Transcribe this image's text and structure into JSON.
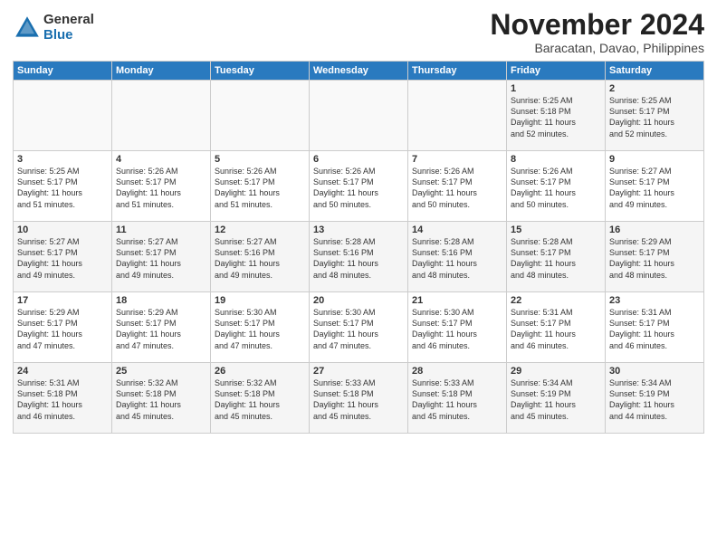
{
  "logo": {
    "general": "General",
    "blue": "Blue"
  },
  "header": {
    "month": "November 2024",
    "location": "Baracatan, Davao, Philippines"
  },
  "weekdays": [
    "Sunday",
    "Monday",
    "Tuesday",
    "Wednesday",
    "Thursday",
    "Friday",
    "Saturday"
  ],
  "weeks": [
    [
      {
        "day": "",
        "info": ""
      },
      {
        "day": "",
        "info": ""
      },
      {
        "day": "",
        "info": ""
      },
      {
        "day": "",
        "info": ""
      },
      {
        "day": "",
        "info": ""
      },
      {
        "day": "1",
        "info": "Sunrise: 5:25 AM\nSunset: 5:18 PM\nDaylight: 11 hours\nand 52 minutes."
      },
      {
        "day": "2",
        "info": "Sunrise: 5:25 AM\nSunset: 5:17 PM\nDaylight: 11 hours\nand 52 minutes."
      }
    ],
    [
      {
        "day": "3",
        "info": "Sunrise: 5:25 AM\nSunset: 5:17 PM\nDaylight: 11 hours\nand 51 minutes."
      },
      {
        "day": "4",
        "info": "Sunrise: 5:26 AM\nSunset: 5:17 PM\nDaylight: 11 hours\nand 51 minutes."
      },
      {
        "day": "5",
        "info": "Sunrise: 5:26 AM\nSunset: 5:17 PM\nDaylight: 11 hours\nand 51 minutes."
      },
      {
        "day": "6",
        "info": "Sunrise: 5:26 AM\nSunset: 5:17 PM\nDaylight: 11 hours\nand 50 minutes."
      },
      {
        "day": "7",
        "info": "Sunrise: 5:26 AM\nSunset: 5:17 PM\nDaylight: 11 hours\nand 50 minutes."
      },
      {
        "day": "8",
        "info": "Sunrise: 5:26 AM\nSunset: 5:17 PM\nDaylight: 11 hours\nand 50 minutes."
      },
      {
        "day": "9",
        "info": "Sunrise: 5:27 AM\nSunset: 5:17 PM\nDaylight: 11 hours\nand 49 minutes."
      }
    ],
    [
      {
        "day": "10",
        "info": "Sunrise: 5:27 AM\nSunset: 5:17 PM\nDaylight: 11 hours\nand 49 minutes."
      },
      {
        "day": "11",
        "info": "Sunrise: 5:27 AM\nSunset: 5:17 PM\nDaylight: 11 hours\nand 49 minutes."
      },
      {
        "day": "12",
        "info": "Sunrise: 5:27 AM\nSunset: 5:16 PM\nDaylight: 11 hours\nand 49 minutes."
      },
      {
        "day": "13",
        "info": "Sunrise: 5:28 AM\nSunset: 5:16 PM\nDaylight: 11 hours\nand 48 minutes."
      },
      {
        "day": "14",
        "info": "Sunrise: 5:28 AM\nSunset: 5:16 PM\nDaylight: 11 hours\nand 48 minutes."
      },
      {
        "day": "15",
        "info": "Sunrise: 5:28 AM\nSunset: 5:17 PM\nDaylight: 11 hours\nand 48 minutes."
      },
      {
        "day": "16",
        "info": "Sunrise: 5:29 AM\nSunset: 5:17 PM\nDaylight: 11 hours\nand 48 minutes."
      }
    ],
    [
      {
        "day": "17",
        "info": "Sunrise: 5:29 AM\nSunset: 5:17 PM\nDaylight: 11 hours\nand 47 minutes."
      },
      {
        "day": "18",
        "info": "Sunrise: 5:29 AM\nSunset: 5:17 PM\nDaylight: 11 hours\nand 47 minutes."
      },
      {
        "day": "19",
        "info": "Sunrise: 5:30 AM\nSunset: 5:17 PM\nDaylight: 11 hours\nand 47 minutes."
      },
      {
        "day": "20",
        "info": "Sunrise: 5:30 AM\nSunset: 5:17 PM\nDaylight: 11 hours\nand 47 minutes."
      },
      {
        "day": "21",
        "info": "Sunrise: 5:30 AM\nSunset: 5:17 PM\nDaylight: 11 hours\nand 46 minutes."
      },
      {
        "day": "22",
        "info": "Sunrise: 5:31 AM\nSunset: 5:17 PM\nDaylight: 11 hours\nand 46 minutes."
      },
      {
        "day": "23",
        "info": "Sunrise: 5:31 AM\nSunset: 5:17 PM\nDaylight: 11 hours\nand 46 minutes."
      }
    ],
    [
      {
        "day": "24",
        "info": "Sunrise: 5:31 AM\nSunset: 5:18 PM\nDaylight: 11 hours\nand 46 minutes."
      },
      {
        "day": "25",
        "info": "Sunrise: 5:32 AM\nSunset: 5:18 PM\nDaylight: 11 hours\nand 45 minutes."
      },
      {
        "day": "26",
        "info": "Sunrise: 5:32 AM\nSunset: 5:18 PM\nDaylight: 11 hours\nand 45 minutes."
      },
      {
        "day": "27",
        "info": "Sunrise: 5:33 AM\nSunset: 5:18 PM\nDaylight: 11 hours\nand 45 minutes."
      },
      {
        "day": "28",
        "info": "Sunrise: 5:33 AM\nSunset: 5:18 PM\nDaylight: 11 hours\nand 45 minutes."
      },
      {
        "day": "29",
        "info": "Sunrise: 5:34 AM\nSunset: 5:19 PM\nDaylight: 11 hours\nand 45 minutes."
      },
      {
        "day": "30",
        "info": "Sunrise: 5:34 AM\nSunset: 5:19 PM\nDaylight: 11 hours\nand 44 minutes."
      }
    ]
  ]
}
